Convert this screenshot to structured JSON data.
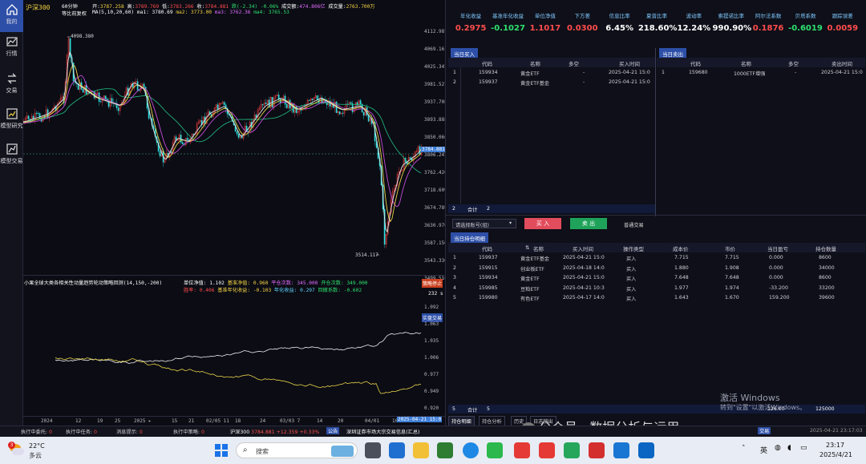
{
  "sidebar": {
    "items": [
      {
        "label": "我的",
        "icon": "home-icon"
      },
      {
        "label": "行情",
        "icon": "chart-icon"
      },
      {
        "label": "交易",
        "icon": "trade-icon"
      },
      {
        "label": "模型研究",
        "icon": "research-icon"
      },
      {
        "label": "模型交易",
        "icon": "model-trade-icon"
      }
    ]
  },
  "chart": {
    "symbol": "沪深300",
    "period": "60分钟",
    "adjust": "等比前复权",
    "ohlc": {
      "open_label": "开:",
      "open": "3787.258",
      "high_label": "高:",
      "high": "3789.769",
      "low_label": "低:",
      "low": "3783.266",
      "close_label": "收:",
      "close": "3784.881",
      "change": "跌(-2.34)",
      "change_pct": "-0.06%",
      "amount_label": "成交额:",
      "amount": "474.806亿",
      "vol_label": "成交量:",
      "volume": "2763.700万"
    },
    "ma": {
      "label": "MA(5,10,20,60)",
      "ma1": "ma1: 3780.69",
      "ma2": "ma2: 3773.00",
      "ma3": "ma3: 3762.36",
      "ma4": "ma4: 3765.53"
    },
    "price_axis": [
      "4112.987",
      "4069.161",
      "4025.347",
      "3981.527",
      "3937.708",
      "3893.888",
      "3850.066",
      "3806.247",
      "3762.420",
      "3718.609",
      "3674.789",
      "3630.970",
      "3587.150",
      "3543.330",
      "3499.510"
    ],
    "current_price": "3784.881",
    "high_marker": "4098.380",
    "low_marker": "3514.117",
    "strategy": {
      "title": "小果全球大类各相关性动量趋势轮动策略回测(14,150,-200)",
      "nav_label": "单位净值:",
      "nav": "1.102",
      "bench_nav_label": "基准净值:",
      "bench_nav": "0.960",
      "trades_label": "平仓次数:",
      "trades": "345.000",
      "pos_label": "开仓次数:",
      "pos": "349.000",
      "win_label": "胜率:",
      "win": "0.406",
      "bench_ret_label": "基准年化收益:",
      "bench_ret": "-0.103",
      "ann_ret_label": "年化收益:",
      "ann_ret": "0.297",
      "beta_label": "回撤系数:",
      "beta": "-0.602",
      "tag_stop": "策略停止",
      "tag_count": "232 s",
      "tag_trade": "实盘交易"
    },
    "lower_axis": [
      "1.092",
      "1.063",
      "1.035",
      "1.006",
      "0.977",
      "0.949",
      "0.920"
    ],
    "date_axis": [
      "2024",
      "12",
      "19",
      "25",
      "2025 ▸",
      "15",
      "21",
      "02/05 11",
      "18",
      "24",
      "03/03 7",
      "14",
      "20",
      "04/01",
      "10"
    ],
    "date_cursor": "2025-04-21 15:0"
  },
  "metrics": [
    {
      "label": "年化收益",
      "value": "0.2975",
      "color": "#ff4d4d"
    },
    {
      "label": "基准年化收益",
      "value": "-0.1027",
      "color": "#2ee06e"
    },
    {
      "label": "单位净值",
      "value": "1.1017",
      "color": "#ff4d4d"
    },
    {
      "label": "下方差",
      "value": "0.0300",
      "color": "#ff4d4d"
    },
    {
      "label": "信息比率",
      "value": "6.45%",
      "color": "#ffffff"
    },
    {
      "label": "夏普比率",
      "value": "218.60%",
      "color": "#ffffff"
    },
    {
      "label": "波动率",
      "value": "12.24%",
      "color": "#ffffff"
    },
    {
      "label": "索提诺比率",
      "value": "990.90%",
      "color": "#ffffff"
    },
    {
      "label": "阿尔法系数",
      "value": "0.1876",
      "color": "#ff4d4d"
    },
    {
      "label": "贝塔系数",
      "value": "-0.6019",
      "color": "#2ee06e"
    },
    {
      "label": "跟踪误差",
      "value": "0.0059",
      "color": "#ff4d4d"
    }
  ],
  "buy_table": {
    "tab": "当日买入",
    "headers": [
      "代码",
      "名称",
      "多空",
      "买入时间"
    ],
    "rows": [
      {
        "no": "1",
        "code": "159934",
        "name": "黄金ETF",
        "dir": "-",
        "time": "2025-04-21 15:0"
      },
      {
        "no": "2",
        "code": "159937",
        "name": "黄金ETF基金",
        "dir": "-",
        "time": "2025-04-21 15:0"
      }
    ],
    "total_count": "2",
    "total_label": "合计",
    "total_value": "2"
  },
  "sell_table": {
    "tab": "当日卖出",
    "headers": [
      "代码",
      "名称",
      "多空",
      "卖出时间"
    ],
    "rows": [
      {
        "no": "1",
        "code": "159680",
        "name": "1000ETF增强",
        "dir": "-",
        "time": "2025-04-21 15:0"
      }
    ]
  },
  "controls": {
    "account_placeholder": "请选择账号(组)",
    "buy_label": "买 入",
    "sell_label": "卖 出",
    "normal_trade": "普通交易"
  },
  "pos_table": {
    "tab": "当日持仓明细",
    "headers": [
      "代码",
      "名称",
      "买入时间",
      "操作类型",
      "成本价",
      "市价",
      "当日盈亏",
      "持仓数量"
    ],
    "rows": [
      {
        "no": "1",
        "code": "159937",
        "name": "黄金ETF基金",
        "time": "2025-04-21 15:0",
        "op": "买入",
        "cost": "7.715",
        "price": "7.715",
        "pnl": "0.000",
        "qty": "8600"
      },
      {
        "no": "2",
        "code": "159915",
        "name": "创业板ETF",
        "time": "2025-04-18 14:0",
        "op": "买入",
        "cost": "1.880",
        "price": "1.908",
        "pnl": "0.000",
        "qty": "34000"
      },
      {
        "no": "3",
        "code": "159934",
        "name": "黄金ETF",
        "time": "2025-04-21 15:0",
        "op": "买入",
        "cost": "7.648",
        "price": "7.648",
        "pnl": "0.000",
        "qty": "8600"
      },
      {
        "no": "4",
        "code": "159985",
        "name": "豆粕ETF",
        "time": "2025-04-21 10:3",
        "op": "买入",
        "cost": "1.977",
        "price": "1.974",
        "pnl": "-33.200",
        "qty": "33200"
      },
      {
        "no": "5",
        "code": "159980",
        "name": "有色ETF",
        "time": "2025-04-17 14:0",
        "op": "买入",
        "cost": "1.643",
        "price": "1.670",
        "pnl": "159.200",
        "qty": "39600"
      }
    ],
    "total_count": "5",
    "total_label": "合计",
    "total_value": "5",
    "total_qty": "125000",
    "total_partial": "126.00"
  },
  "bottom_tabs": [
    "持仓明细",
    "持仓分析",
    "历史",
    "日志输出"
  ],
  "status": {
    "entrust_label": "执行中委托:",
    "entrust": "0",
    "task_label": "执行中任务:",
    "task": "0",
    "msg_label": "消息提示:",
    "msg": "0",
    "strategy_label": "执行中策略:",
    "strategy": "0",
    "index_name": "沪深300",
    "index_price": "3784.881",
    "index_chg": "+12.359",
    "index_pct": "+0.33%",
    "notice_tag": "公告",
    "notice_text": "深圳证券市场大宗交易信息(汇总)",
    "trade_tag": "交易",
    "clock": "2025-04-21 23:17:03"
  },
  "watermark": {
    "activate_title": "激活 Windows",
    "activate_sub": "转到\"设置\"以激活Windows。",
    "wechat": "公众号 · 数据分析与运用"
  },
  "taskbar": {
    "weather_temp": "22°C",
    "weather_desc": "多云",
    "weather_badge": "3",
    "search_placeholder": "搜索",
    "ime": "英",
    "time": "23:17",
    "date": "2025/4/21"
  }
}
